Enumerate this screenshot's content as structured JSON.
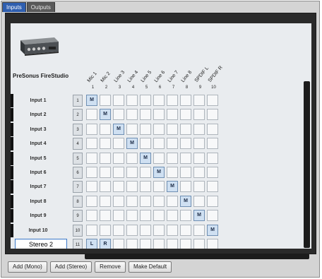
{
  "tabs": [
    {
      "label": "Inputs",
      "active": true
    },
    {
      "label": "Outputs",
      "active": false
    }
  ],
  "device": {
    "name": "PreSonus FireStudio",
    "image_icon": "audio-interface-icon"
  },
  "columns": [
    {
      "label": "Mic 1",
      "num": "1"
    },
    {
      "label": "Mic 2",
      "num": "2"
    },
    {
      "label": "Line 3",
      "num": "3"
    },
    {
      "label": "Line 4",
      "num": "4"
    },
    {
      "label": "Line 5",
      "num": "5"
    },
    {
      "label": "Line 6",
      "num": "6"
    },
    {
      "label": "Line 7",
      "num": "7"
    },
    {
      "label": "Line 8",
      "num": "8"
    },
    {
      "label": "SPDIF L",
      "num": "9"
    },
    {
      "label": "SPDIF R",
      "num": "10"
    }
  ],
  "rows": [
    {
      "label": "Input 1",
      "num": "1",
      "active_col": 0,
      "mark": "M"
    },
    {
      "label": "Input 2",
      "num": "2",
      "active_col": 1,
      "mark": "M"
    },
    {
      "label": "Input 3",
      "num": "3",
      "active_col": 2,
      "mark": "M"
    },
    {
      "label": "Input 4",
      "num": "4",
      "active_col": 3,
      "mark": "M"
    },
    {
      "label": "Input 5",
      "num": "5",
      "active_col": 4,
      "mark": "M"
    },
    {
      "label": "Input 6",
      "num": "6",
      "active_col": 5,
      "mark": "M"
    },
    {
      "label": "Input 7",
      "num": "7",
      "active_col": 6,
      "mark": "M"
    },
    {
      "label": "Input 8",
      "num": "8",
      "active_col": 7,
      "mark": "M"
    },
    {
      "label": "Input 9",
      "num": "9",
      "active_col": 8,
      "mark": "M"
    },
    {
      "label": "Input 10",
      "num": "10",
      "active_col": 9,
      "mark": "M"
    }
  ],
  "editing_row": {
    "value": "Stereo 2",
    "num": "11",
    "marks": [
      {
        "col": 0,
        "mark": "L"
      },
      {
        "col": 1,
        "mark": "R"
      }
    ]
  },
  "buttons": {
    "add_mono": "Add (Mono)",
    "add_stereo": "Add (Stereo)",
    "remove": "Remove",
    "make_default": "Make Default"
  }
}
